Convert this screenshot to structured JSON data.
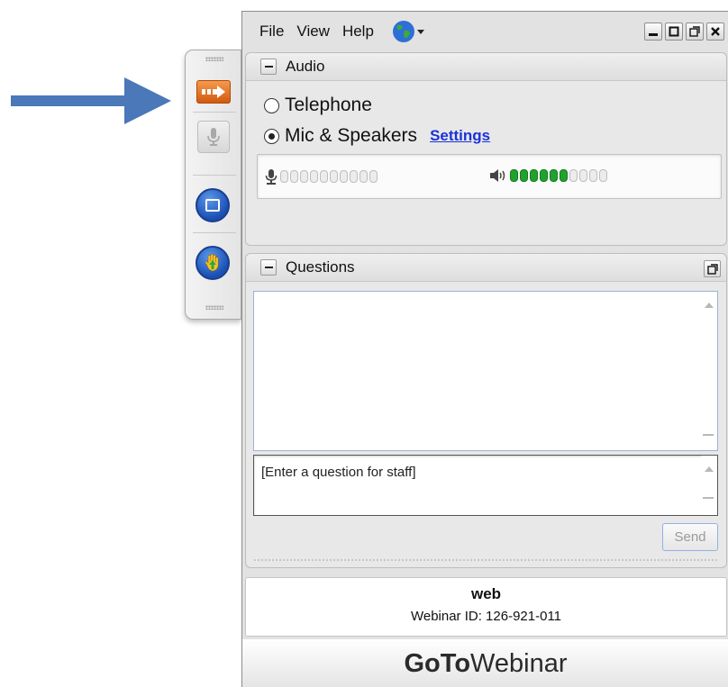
{
  "menu": {
    "file": "File",
    "view": "View",
    "help": "Help"
  },
  "audio": {
    "title": "Audio",
    "option_telephone": "Telephone",
    "option_mic": "Mic & Speakers",
    "selected": "Mic & Speakers",
    "settings_link": "Settings",
    "mic_level_segments": 0,
    "speaker_level_segments": 6,
    "meter_segment_count": 10
  },
  "questions": {
    "title": "Questions",
    "input_placeholder": "[Enter a question for staff]",
    "send_label": "Send"
  },
  "info": {
    "name": "web",
    "webinar_id": "Webinar ID: 126-921-011"
  },
  "brand": {
    "go": "Go",
    "to": "To",
    "webinar": "Webinar"
  },
  "colors": {
    "annotation_arrow": "#4a78b8",
    "control_orange": "#e8701f",
    "control_blue": "#2a5fc9",
    "meter_green": "#1fa32c",
    "link": "#1b33d8"
  },
  "icons": {
    "control_arrow": "arrow-right-icon",
    "control_mic": "microphone-icon",
    "control_screen": "screen-icon",
    "control_hand": "raise-hand-icon",
    "globe": "globe-icon"
  }
}
